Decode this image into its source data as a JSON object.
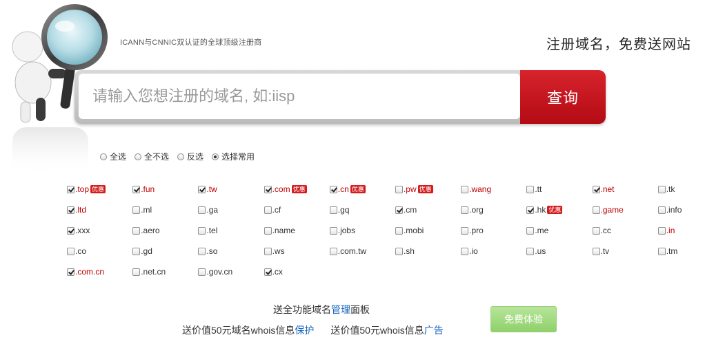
{
  "header": {
    "tagline": "ICANN与CNNIC双认证的全球顶级注册商",
    "slogan": "注册域名，免费送网站"
  },
  "search": {
    "placeholder": "请输入您想注册的域名, 如:iisp",
    "button_label": "查询"
  },
  "radio_options": [
    {
      "label": "全选",
      "selected": false
    },
    {
      "label": "全不选",
      "selected": false
    },
    {
      "label": "反选",
      "selected": false
    },
    {
      "label": "选择常用",
      "selected": true
    }
  ],
  "promo_badge": "优惠",
  "tlds": [
    {
      "label": ".top",
      "checked": true,
      "red": true,
      "promo": true
    },
    {
      "label": ".fun",
      "checked": true,
      "red": true,
      "promo": false
    },
    {
      "label": ".tw",
      "checked": true,
      "red": true,
      "promo": false
    },
    {
      "label": ".com",
      "checked": true,
      "red": true,
      "promo": true
    },
    {
      "label": ".cn",
      "checked": true,
      "red": true,
      "promo": true
    },
    {
      "label": ".pw",
      "checked": false,
      "red": true,
      "promo": true
    },
    {
      "label": ".wang",
      "checked": false,
      "red": true,
      "promo": false
    },
    {
      "label": ".tt",
      "checked": false,
      "red": false,
      "promo": false
    },
    {
      "label": ".net",
      "checked": true,
      "red": true,
      "promo": false
    },
    {
      "label": ".tk",
      "checked": false,
      "red": false,
      "promo": false
    },
    {
      "label": ".ltd",
      "checked": true,
      "red": true,
      "promo": false
    },
    {
      "label": ".ml",
      "checked": false,
      "red": false,
      "promo": false
    },
    {
      "label": ".ga",
      "checked": false,
      "red": false,
      "promo": false
    },
    {
      "label": ".cf",
      "checked": false,
      "red": false,
      "promo": false
    },
    {
      "label": ".gq",
      "checked": false,
      "red": false,
      "promo": false
    },
    {
      "label": ".cm",
      "checked": true,
      "red": false,
      "promo": false
    },
    {
      "label": ".org",
      "checked": false,
      "red": false,
      "promo": false
    },
    {
      "label": ".hk",
      "checked": true,
      "red": false,
      "promo": true
    },
    {
      "label": ".game",
      "checked": false,
      "red": true,
      "promo": false
    },
    {
      "label": ".info",
      "checked": false,
      "red": false,
      "promo": false
    },
    {
      "label": ".xxx",
      "checked": true,
      "red": false,
      "promo": false
    },
    {
      "label": ".aero",
      "checked": false,
      "red": false,
      "promo": false
    },
    {
      "label": ".tel",
      "checked": false,
      "red": false,
      "promo": false
    },
    {
      "label": ".name",
      "checked": false,
      "red": false,
      "promo": false
    },
    {
      "label": ".jobs",
      "checked": false,
      "red": false,
      "promo": false
    },
    {
      "label": ".mobi",
      "checked": false,
      "red": false,
      "promo": false
    },
    {
      "label": ".pro",
      "checked": false,
      "red": false,
      "promo": false
    },
    {
      "label": ".me",
      "checked": false,
      "red": false,
      "promo": false
    },
    {
      "label": ".cc",
      "checked": false,
      "red": false,
      "promo": false
    },
    {
      "label": ".in",
      "checked": false,
      "red": true,
      "promo": false
    },
    {
      "label": ".co",
      "checked": false,
      "red": false,
      "promo": false
    },
    {
      "label": ".gd",
      "checked": false,
      "red": false,
      "promo": false
    },
    {
      "label": ".so",
      "checked": false,
      "red": false,
      "promo": false
    },
    {
      "label": ".ws",
      "checked": false,
      "red": false,
      "promo": false
    },
    {
      "label": ".com.tw",
      "checked": false,
      "red": false,
      "promo": false
    },
    {
      "label": ".sh",
      "checked": false,
      "red": false,
      "promo": false
    },
    {
      "label": ".io",
      "checked": false,
      "red": false,
      "promo": false
    },
    {
      "label": ".us",
      "checked": false,
      "red": false,
      "promo": false
    },
    {
      "label": ".tv",
      "checked": false,
      "red": false,
      "promo": false
    },
    {
      "label": ".tm",
      "checked": false,
      "red": false,
      "promo": false
    },
    {
      "label": ".com.cn",
      "checked": true,
      "red": true,
      "promo": false
    },
    {
      "label": ".net.cn",
      "checked": false,
      "red": false,
      "promo": false
    },
    {
      "label": ".gov.cn",
      "checked": false,
      "red": false,
      "promo": false
    },
    {
      "label": ".cx",
      "checked": true,
      "red": false,
      "promo": false
    }
  ],
  "bottom": {
    "line1_prefix": "送全功能域名",
    "line1_link": "管理",
    "line1_suffix": "面板",
    "line2_part1_prefix": "送价值50元域名whois信息",
    "line2_part1_link": "保护",
    "line2_part2_prefix": "送价值50元whois信息",
    "line2_part2_link": "广告",
    "trial_button_label": "免费体验"
  },
  "colors": {
    "search_button": "#c8121b",
    "highlight_tld": "#c00000",
    "link": "#1565c0",
    "trial_button": "#9fd97e"
  },
  "icons": {
    "illustration": "magnifier-figure-icon"
  }
}
